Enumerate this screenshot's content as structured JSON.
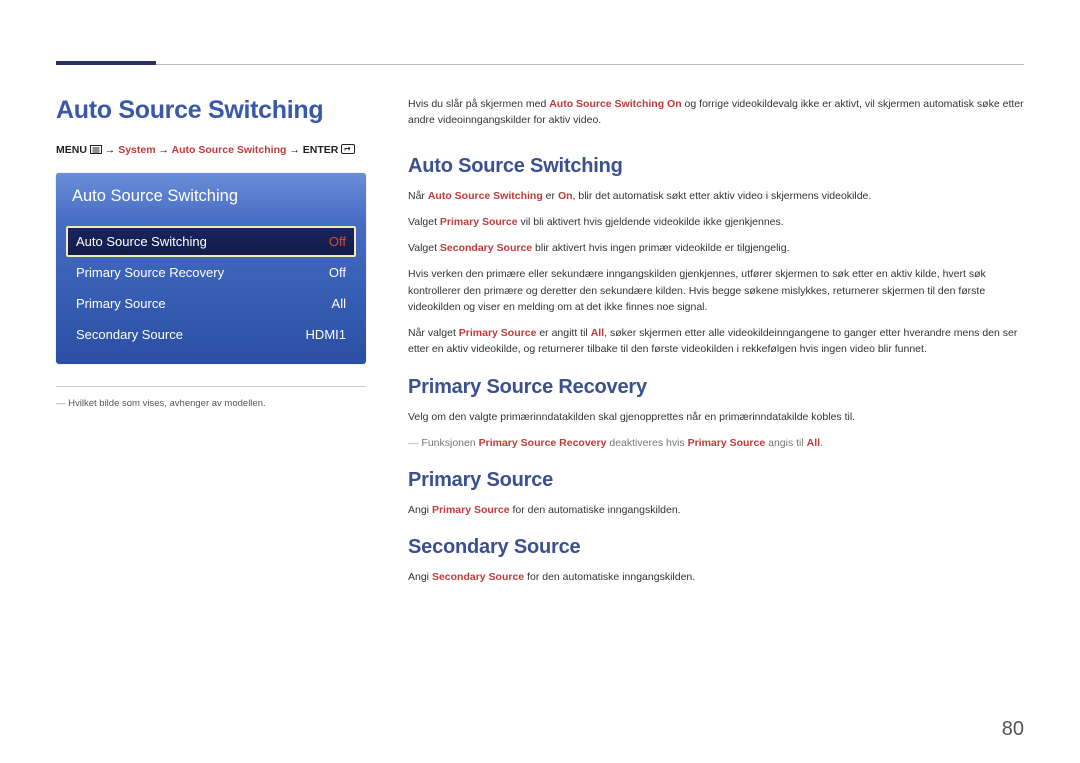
{
  "page_number": "80",
  "left": {
    "title": "Auto Source Switching",
    "breadcrumb": {
      "menu": "MENU",
      "arrow": "→",
      "system": "System",
      "ass": "Auto Source Switching",
      "enter": "ENTER"
    },
    "osd": {
      "title": "Auto Source Switching",
      "rows": [
        {
          "label": "Auto Source Switching",
          "value": "Off",
          "selected": true
        },
        {
          "label": "Primary Source Recovery",
          "value": "Off",
          "selected": false
        },
        {
          "label": "Primary Source",
          "value": "All",
          "selected": false
        },
        {
          "label": "Secondary Source",
          "value": "HDMI1",
          "selected": false
        }
      ]
    },
    "footnote": "Hvilket bilde som vises, avhenger av modellen."
  },
  "right": {
    "intro_pre": "Hvis du slår på skjermen med ",
    "intro_kw": "Auto Source Switching On",
    "intro_post": " og forrige videokildevalg ikke er aktivt, vil skjermen automatisk søke etter andre videoinngangskilder for aktiv video.",
    "h_ass": "Auto Source Switching",
    "p_ass_1_pre": "Når ",
    "p_ass_1_kw1": "Auto Source Switching",
    "p_ass_1_mid": " er ",
    "p_ass_1_kw2": "On",
    "p_ass_1_post": ", blir det automatisk søkt etter aktiv video i skjermens videokilde.",
    "p_ass_2_pre": "Valget ",
    "p_ass_2_kw": "Primary Source",
    "p_ass_2_post": " vil bli aktivert hvis gjeldende videokilde ikke gjenkjennes.",
    "p_ass_3_pre": "Valget ",
    "p_ass_3_kw": "Secondary Source",
    "p_ass_3_post": " blir aktivert hvis ingen primær videokilde er tilgjengelig.",
    "p_ass_4": "Hvis verken den primære eller sekundære inngangskilden gjenkjennes, utfører skjermen to søk etter en aktiv kilde, hvert søk kontrollerer den primære og deretter den sekundære kilden. Hvis begge søkene mislykkes, returnerer skjermen til den første videokilden og viser en melding om at det ikke finnes noe signal.",
    "p_ass_5_pre": "Når valget ",
    "p_ass_5_kw1": "Primary Source",
    "p_ass_5_mid": " er angitt til ",
    "p_ass_5_kw2": "All",
    "p_ass_5_post": ", søker skjermen etter alle videokildeinngangene to ganger etter hverandre mens den ser etter en aktiv videokilde, og returnerer tilbake til den første videokilden i rekkefølgen hvis ingen video blir funnet.",
    "h_psr": "Primary Source Recovery",
    "p_psr_1": "Velg om den valgte primærinndatakilden skal gjenopprettes når en primærinndatakilde kobles til.",
    "psr_note_pre": "Funksjonen ",
    "psr_note_kw1": "Primary Source Recovery",
    "psr_note_mid": " deaktiveres hvis ",
    "psr_note_kw2": "Primary Source",
    "psr_note_mid2": " angis til ",
    "psr_note_kw3": "All",
    "psr_note_post": ".",
    "h_ps": "Primary Source",
    "p_ps_pre": "Angi ",
    "p_ps_kw": "Primary Source",
    "p_ps_post": " for den automatiske inngangskilden.",
    "h_ss": "Secondary Source",
    "p_ss_pre": "Angi ",
    "p_ss_kw": "Secondary Source",
    "p_ss_post": " for den automatiske inngangskilden."
  }
}
